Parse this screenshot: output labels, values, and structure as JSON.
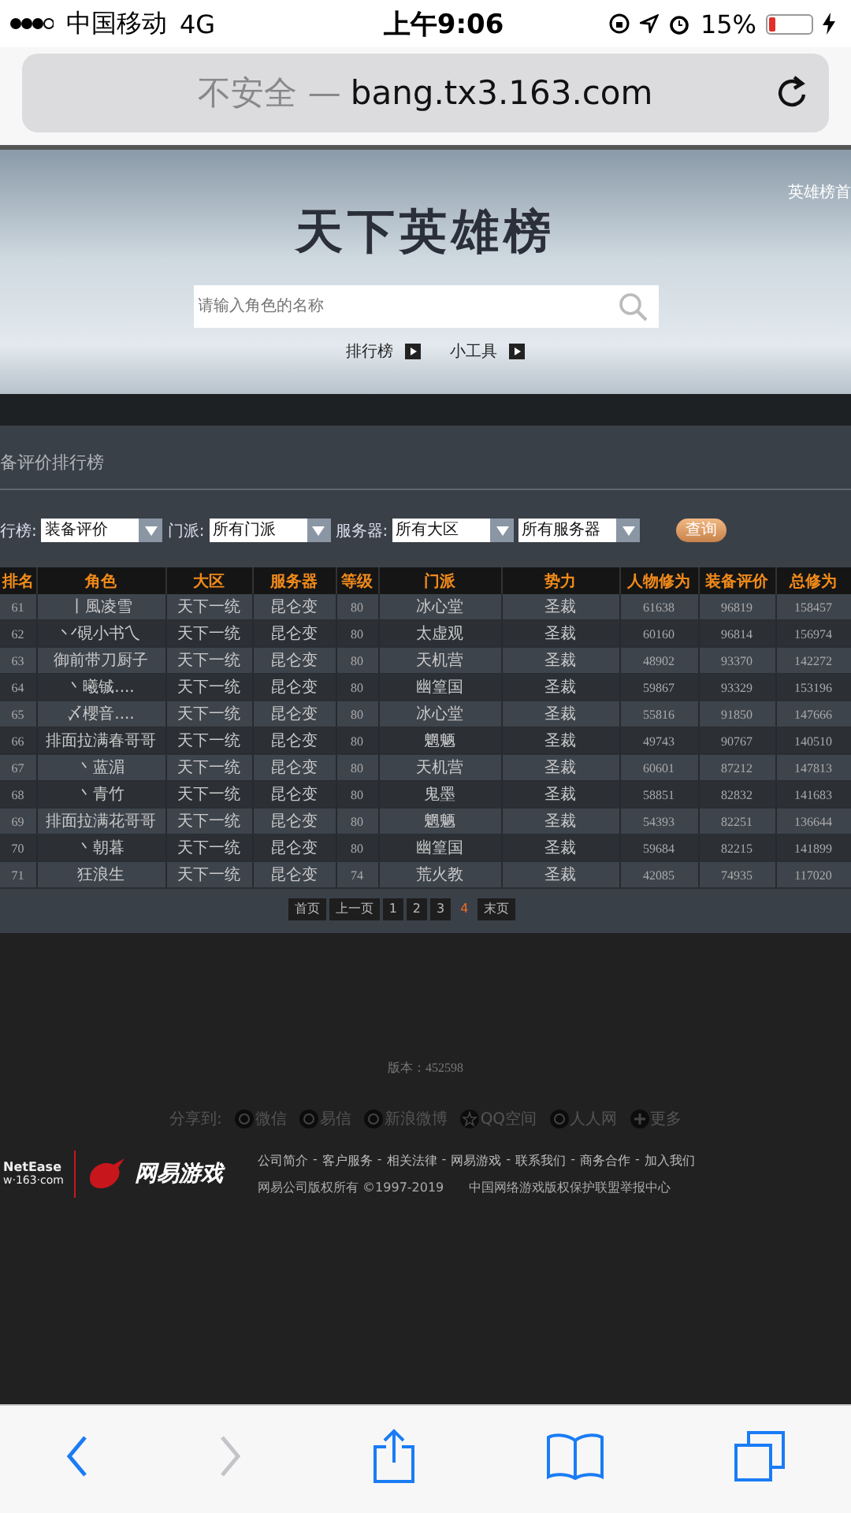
{
  "status_bar": {
    "carrier": "中国移动",
    "network": "4G",
    "time": "上午9:06",
    "battery_percent": "15%",
    "battery": {
      "level": 0.15
    }
  },
  "address_bar": {
    "security": "不安全",
    "separator": "—",
    "url": "bang.tx3.163.com"
  },
  "banner": {
    "corner_link": "英雄榜首",
    "title": "天下英雄榜",
    "search": {
      "placeholder": "请输入角色的名称"
    },
    "links": [
      "排行榜",
      "小工具"
    ]
  },
  "section_title": "备评价排行榜",
  "filters": [
    {
      "label": "行榜:",
      "value": "装备评价"
    },
    {
      "label": "门派:",
      "value": "所有门派"
    },
    {
      "label": "服务器:",
      "value": "所有大区"
    },
    {
      "value": "所有服务器"
    }
  ],
  "query_button": "查询",
  "table": {
    "columns": [
      "排名",
      "角色",
      "大区",
      "服务器",
      "等级",
      "门派",
      "势力",
      "人物修为",
      "装备评价",
      "总修为"
    ],
    "rows": [
      [
        "61",
        "丨風凌雪",
        "天下一统",
        "昆仑变",
        "80",
        "冰心堂",
        "圣裁",
        "61638",
        "96819",
        "158457"
      ],
      [
        "62",
        "丷硯小书乀",
        "天下一统",
        "昆仑变",
        "80",
        "太虚观",
        "圣裁",
        "60160",
        "96814",
        "156974"
      ],
      [
        "63",
        "御前带刀厨子",
        "天下一统",
        "昆仑变",
        "80",
        "天机营",
        "圣裁",
        "48902",
        "93370",
        "142272"
      ],
      [
        "64",
        "丶曦铖....",
        "天下一统",
        "昆仑变",
        "80",
        "幽篁国",
        "圣裁",
        "59867",
        "93329",
        "153196"
      ],
      [
        "65",
        "〆櫻音....",
        "天下一统",
        "昆仑变",
        "80",
        "冰心堂",
        "圣裁",
        "55816",
        "91850",
        "147666"
      ],
      [
        "66",
        "排面拉满春哥哥",
        "天下一统",
        "昆仑变",
        "80",
        "魍魉",
        "圣裁",
        "49743",
        "90767",
        "140510"
      ],
      [
        "67",
        "丶蓝湄",
        "天下一统",
        "昆仑变",
        "80",
        "天机营",
        "圣裁",
        "60601",
        "87212",
        "147813"
      ],
      [
        "68",
        "丶青竹",
        "天下一统",
        "昆仑变",
        "80",
        "鬼墨",
        "圣裁",
        "58851",
        "82832",
        "141683"
      ],
      [
        "69",
        "排面拉满花哥哥",
        "天下一统",
        "昆仑变",
        "80",
        "魍魉",
        "圣裁",
        "54393",
        "82251",
        "136644"
      ],
      [
        "70",
        "丶朝暮",
        "天下一统",
        "昆仑变",
        "80",
        "幽篁国",
        "圣裁",
        "59684",
        "82215",
        "141899"
      ],
      [
        "71",
        "狂浪生",
        "天下一统",
        "昆仑变",
        "74",
        "荒火教",
        "圣裁",
        "42085",
        "74935",
        "117020"
      ]
    ]
  },
  "pagination": [
    {
      "label": "首页",
      "selected": false
    },
    {
      "label": "上一页",
      "selected": false
    },
    {
      "label": "1",
      "selected": false
    },
    {
      "label": "2",
      "selected": false
    },
    {
      "label": "3",
      "selected": false
    },
    {
      "label": "4",
      "selected": true
    },
    {
      "label": "末页",
      "selected": false
    }
  ],
  "footer": {
    "version_label": "版本：",
    "version": "452598",
    "share_label": "分享到:",
    "share": [
      "微信",
      "易信",
      "新浪微博",
      "QQ空间",
      "人人网",
      "更多"
    ],
    "logo": {
      "brand": "NetEase",
      "site": "w·163·com",
      "games": "网易游戏"
    },
    "links": [
      "公司简介",
      "-",
      "客户服务",
      "-",
      "相关法律",
      "-",
      "网易游戏",
      "-",
      "联系我们",
      "-",
      "商务合作",
      "-",
      "加入我们"
    ],
    "copyright": "网易公司版权所有 ©1997-2019",
    "report": "中国网络游戏版权保护联盟举报中心"
  }
}
